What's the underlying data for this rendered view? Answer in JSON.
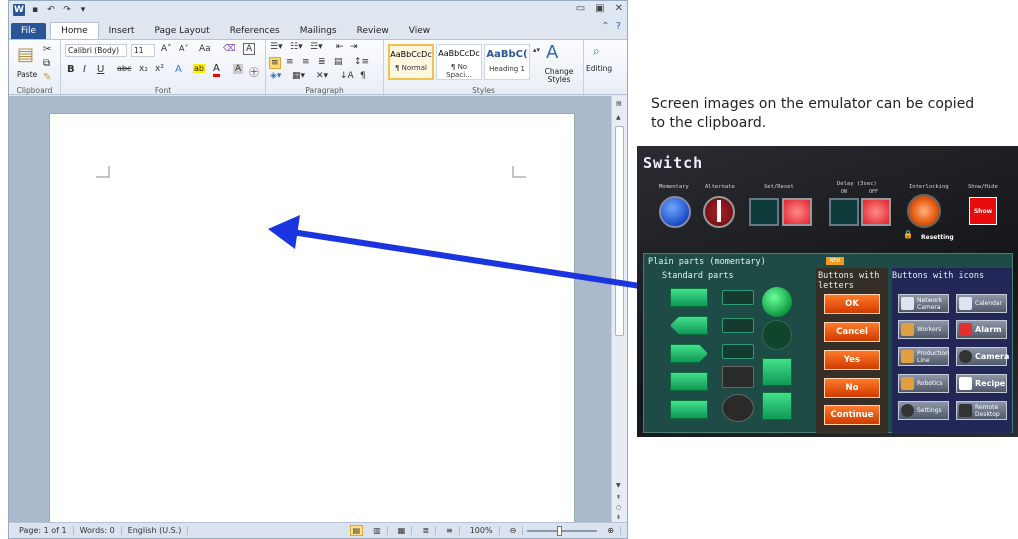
{
  "word": {
    "title_controls": [
      "▭",
      "▣",
      "✕"
    ],
    "quick_access": [
      "W",
      "💾",
      "↶",
      "↷",
      "▾"
    ],
    "tabs": [
      "File",
      "Home",
      "Insert",
      "Page Layout",
      "References",
      "Mailings",
      "Review",
      "View"
    ],
    "ribbon": {
      "clipboard": {
        "paste": "Paste",
        "label": "Clipboard"
      },
      "font": {
        "name": "Calibri (Body)",
        "size": "11",
        "label": "Font"
      },
      "paragraph": {
        "label": "Paragraph"
      },
      "styles": {
        "items": [
          {
            "sample": "AaBbCcDc",
            "name": "¶ Normal"
          },
          {
            "sample": "AaBbCcDc",
            "name": "¶ No Spaci..."
          },
          {
            "sample": "AaBbC(",
            "name": "Heading 1"
          }
        ],
        "change_styles": "Change Styles",
        "label": "Styles"
      },
      "editing": {
        "label": "Editing"
      }
    },
    "status": {
      "page": "Page: 1 of 1",
      "words": "Words: 0",
      "language": "English (U.S.)",
      "zoom": "100%"
    }
  },
  "caption": "Screen images on the emulator can be copied to the clipboard.",
  "emulator": {
    "title": "Switch",
    "captions": [
      "Momentary",
      "Alternate",
      "Set/Reset",
      "Delay (3sec)",
      "Interlocking",
      "Show/Hide"
    ],
    "delay_on": "ON",
    "delay_off": "OFF",
    "show_label": "Show",
    "resetting": "Resetting",
    "plain_parts": "Plain parts (momentary)",
    "new_badge": "NEW",
    "standard_parts": "Standard parts",
    "buttons_with_letters": "Buttons with letters",
    "buttons_with_icons": "Buttons with icons",
    "letter_buttons": [
      "OK",
      "Cancel",
      "Yes",
      "No",
      "Continue"
    ],
    "icon_buttons": [
      [
        "Network Camera",
        "Calendar"
      ],
      [
        "Workers",
        "Alarm"
      ],
      [
        "Production Line",
        "Camera"
      ],
      [
        "Robotics",
        "Recipe"
      ],
      [
        "Settings",
        "Remote Desktop"
      ]
    ]
  },
  "colors": {
    "arrow": "#1a35e0",
    "file_tab": "#2a5699",
    "orange": "#e2550c"
  }
}
